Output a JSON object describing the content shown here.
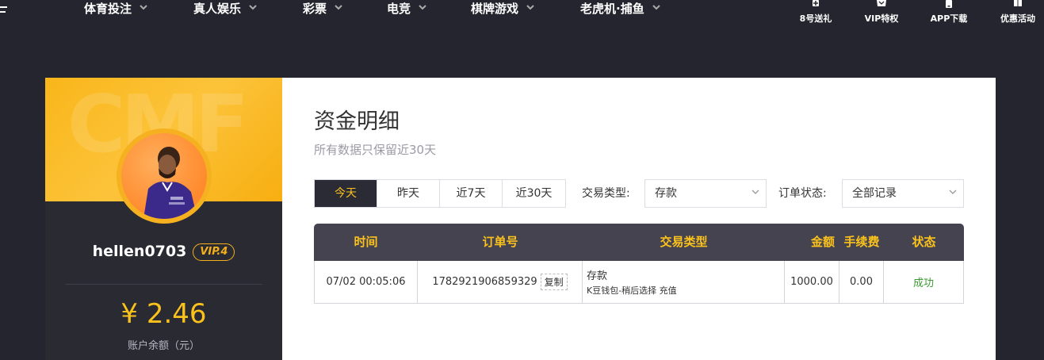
{
  "nav": {
    "items": [
      {
        "label": "体育投注"
      },
      {
        "label": "真人娱乐"
      },
      {
        "label": "彩票"
      },
      {
        "label": "电竞"
      },
      {
        "label": "棋牌游戏"
      },
      {
        "label": "老虎机·捕鱼"
      }
    ],
    "quick": [
      {
        "label": "8号送礼",
        "icon": "gift-icon"
      },
      {
        "label": "VIP特权",
        "icon": "crown-icon"
      },
      {
        "label": "APP下载",
        "icon": "phone-icon"
      },
      {
        "label": "优惠活动",
        "icon": "grid-icon"
      }
    ]
  },
  "profile": {
    "username": "hellen0703",
    "vip": "VIP.4",
    "balance": "¥ 2.46",
    "balance_label": "账户余额（元）",
    "banner_watermark": "CMF"
  },
  "main": {
    "title": "资金明细",
    "subtitle": "所有数据只保留近30天",
    "range_tabs": [
      {
        "label": "今天"
      },
      {
        "label": "昨天"
      },
      {
        "label": "近7天"
      },
      {
        "label": "近30天"
      }
    ],
    "filters": {
      "type_label": "交易类型:",
      "type_value": "存款",
      "status_label": "订单状态:",
      "status_value": "全部记录"
    },
    "table": {
      "headers": [
        "时间",
        "订单号",
        "交易类型",
        "金额",
        "手续费",
        "状态"
      ],
      "rows": [
        {
          "time": "07/02 00:05:06",
          "order": "1782921906859329",
          "copy": "复制",
          "type_main": "存款",
          "type_detail": "K豆钱包-稍后选择 充值",
          "amount": "1000.00",
          "fee": "0.00",
          "status": "成功"
        }
      ]
    }
  },
  "colors": {
    "accent": "#fbc21c",
    "page_bg": "#25252f",
    "table_header": "#45434f",
    "success": "#3d9a34"
  }
}
